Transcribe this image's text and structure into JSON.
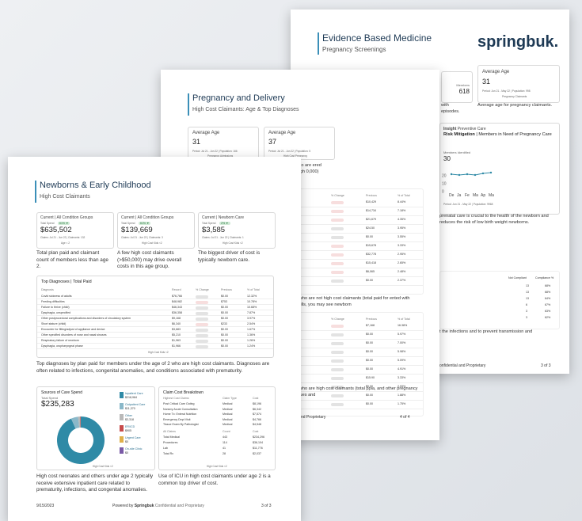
{
  "page3": {
    "title": "Evidence Based Medicine",
    "subtitle": "Pregnancy Screenings",
    "logo": "springbuk.",
    "kpis": [
      {
        "label": "Members",
        "value": "618"
      },
      {
        "label": "Average Age",
        "value": "31",
        "meta": "Period: Jun 21 - May 22 | Population: 998",
        "link": "Pregnancy Claimants"
      }
    ],
    "kpi_notes": [
      "with",
      "episodes."
    ],
    "avg_age_note": "Average age for pregnancy claimants.",
    "insight_title_bold": "Risk Mitigation",
    "insight_title_rest": "| Members in Need of Pregnancy Care",
    "insight_kicker": "Insight",
    "insight_kicker_rest": "Preventive Care",
    "members_identified_label": "Members Identified",
    "members_identified_value": "30",
    "line_chart": {
      "values": [
        22,
        21,
        22,
        21,
        23,
        24
      ],
      "xlabels": [
        "De",
        "Ja",
        "Fe",
        "Ma",
        "Ap",
        "Ma"
      ],
      "yticks": [
        "20",
        "10",
        "0"
      ],
      "meta": "Period: Jun 21 - May 22 | Population: 9968"
    },
    "note1": "prenatal care is crucial to the health of the newborn and reduces the risk of low birth weight newborns.",
    "compliance_header": [
      "Not Compliant",
      "Compliance %"
    ],
    "compliance_rows": [
      [
        "13",
        "68%"
      ],
      [
        "13",
        "68%"
      ],
      [
        "13",
        "64%"
      ],
      [
        "6",
        "67%"
      ],
      [
        "3",
        "63%"
      ],
      [
        "3",
        "62%"
      ]
    ],
    "note2": "t the infections and to prevent transmission and",
    "footer_left": "onfidential and Proprietary",
    "footer_right": "3 of 3"
  },
  "page2": {
    "title": "Pregnancy and Delivery",
    "subtitle": "High Cost Claimants: Age & Top Diagnoses",
    "kpis": [
      {
        "label": "Average Age",
        "value": "31",
        "meta": "Period: Jul 21 - Jun 22 | Population: 166",
        "link": "Pregnancy Admissions"
      },
      {
        "label": "Average Age",
        "value": "37",
        "meta": "Period: Jul 21 - Jun 22 | Population: 5",
        "link": "High Cost Pregnancy"
      }
    ],
    "right_note": "embers who are ered who are high 0,000)",
    "table1_header": [
      "Record",
      "% Change",
      "Previous",
      "% of Total"
    ],
    "table1_rows": [
      [
        "$25,168",
        "",
        "$10,429",
        "8.44%"
      ],
      [
        "$20,384",
        "",
        "$14,734",
        "7.18%"
      ],
      [
        "$12,628",
        "",
        "$21,679",
        "4.35%"
      ],
      [
        "$14,261",
        "",
        "$24.50",
        "3.95%"
      ],
      [
        "$15,120",
        "",
        "$0.00",
        "3.55%"
      ],
      [
        "$11,877",
        "",
        "$15,678",
        "3.33%"
      ],
      [
        "$10,720",
        "",
        "$32,778",
        "2.95%"
      ],
      [
        "$7,298",
        "",
        "$15,418",
        "2.65%"
      ],
      [
        "$9,018",
        "",
        "$6,065",
        "2.48%"
      ],
      [
        "$10,357",
        "",
        "$0.00",
        "2.37%"
      ]
    ],
    "note_mid": "members who are not high cost claimants (total paid for ented with maternal bills, you may see newborn",
    "table2_rows": [
      [
        "$86,719",
        "",
        "$7,168",
        "16.38%"
      ],
      [
        "$28,497",
        "",
        "$0.00",
        "5.97%"
      ],
      [
        "$29,161",
        "",
        "$0.00",
        "7.00%"
      ],
      [
        "$20,753",
        "",
        "$0.00",
        "5.98%"
      ],
      [
        "$20,808",
        "",
        "$0.00",
        "5.09%"
      ],
      [
        "$22,185",
        "",
        "$0.00",
        "4.91%"
      ],
      [
        "$14,862",
        "",
        "$15.90",
        "3.33%"
      ],
      [
        "$13,195",
        "",
        "$0.00",
        "2.93%"
      ],
      [
        "$9,130",
        "",
        "$0.00",
        "1.88%"
      ],
      [
        "$8,994",
        "",
        "$0.00",
        "1.75%"
      ]
    ],
    "note_bottom": "members who are high cost claimants (total ppia, and other pregnancy related issues and",
    "footer_left": "onfidential and Proprietary",
    "footer_right": "4 of 4"
  },
  "page1": {
    "title": "Newborns & Early Childhood",
    "subtitle": "High Cost Claimants",
    "kpis": [
      {
        "heading": "Current | All Condition Groups",
        "label": "Total Spend",
        "badge": "61% ▼",
        "value": "$635,502",
        "meta": "Claims: Jul 21 - Jun 22 | Claimants: 132",
        "link": "Age < 2"
      },
      {
        "heading": "Current | All Condition Groups",
        "label": "Total Spend",
        "badge": "61% ▼",
        "value": "$139,669",
        "meta": "Claims: Jul 21 - Jun 22 | Claimants: 3",
        "link": "High Cost Kids <2"
      },
      {
        "heading": "Current | Newborn Care",
        "label": "Total Spend",
        "badge": "2% ▼",
        "value": "$3,585",
        "meta": "Claims: Jul 21 - Jun 22 | Claimants: 1",
        "link": "High Cost Kids <2"
      }
    ],
    "kpi_notes": [
      "Total plan paid and claimant count of members less than age 2.",
      "A few high cost claimants (>$50,000) may drive overall costs in this age group.",
      "The biggest driver of cost is typically newborn care."
    ],
    "diag_title": "Top Diagnoses | Total Paid",
    "diag_header": [
      "Diagnosis",
      "Record",
      "% Change",
      "Previous",
      "% of Total"
    ],
    "diag_rows": [
      [
        "Covid sickness of adults",
        "$76,766",
        "",
        "$0.00",
        "12.32%"
      ],
      [
        "Feeding difficulties",
        "$48,982",
        "",
        "$753",
        "10.78%"
      ],
      [
        "Failure to thrive (child)",
        "$46,343",
        "",
        "$0.00",
        "10.68%"
      ],
      [
        "Dysphagia, unspecified",
        "$36,358",
        "",
        "$0.00",
        "7.87%"
      ],
      [
        "Other postprocedural complications and disorders of circulatory system",
        "$9,168",
        "",
        "$0.00",
        "3.97%"
      ],
      [
        "Short stature (child)",
        "$6,340",
        "",
        "$233",
        "2.54%"
      ],
      [
        "Encounter for fitting/adjust of appliance and device",
        "$3,683",
        "",
        "$0.00",
        "1.67%"
      ],
      [
        "Other specified disorders of nose and nasal sinuses",
        "$5,210",
        "",
        "$0.00",
        "1.36%"
      ],
      [
        "Respiratory failure of newborn",
        "$1,963",
        "",
        "$0.00",
        "1.26%"
      ],
      [
        "Dysphagia, oropharyngeal phase",
        "$1,966",
        "",
        "$0.00",
        "1.24%"
      ]
    ],
    "diag_link": "High Cost Kids <2",
    "diag_note": "Top diagnoses by plan paid for members under the age of 2 who are high cost claimants.  Diagnoses are often related to infections, congenital anomalies, and conditions associated with prematurity.",
    "sources_title": "Sources of Care Spend",
    "sources_label": "Total Spend",
    "sources_total": "$235,283",
    "sources": [
      {
        "name": "Inpatient Care",
        "value": "$218,984",
        "color": "#2f8aa6"
      },
      {
        "name": "Outpatient Care",
        "value": "$11,370",
        "color": "#8ab8c9"
      },
      {
        "name": "Other",
        "value": "$3,318",
        "color": "#b9b9b9"
      },
      {
        "name": "ER/ICD",
        "value": "$905",
        "color": "#c74b4b"
      },
      {
        "name": "Urgent Care",
        "value": "$0",
        "color": "#e0b04a"
      },
      {
        "name": "On-site Clinic",
        "value": "$0",
        "color": "#7a5aa6"
      }
    ],
    "sources_link": "High Cost Kids <2",
    "breakdown_title": "Claim Cost Breakdown",
    "breakdown_header": [
      "Highest Cost Claims",
      "Claim Type",
      "Cost"
    ],
    "breakdown_rows": [
      [
        "Post Critical Care Outing",
        "Medical",
        "$8,196"
      ],
      [
        "Nursery Acute Consultation",
        "Medical",
        "$6,342"
      ],
      [
        "Home Tx: Enteral Nutrition",
        "Medical",
        "$7,574"
      ],
      [
        "Emergency Dept Visit",
        "Medical",
        "$4,766"
      ],
      [
        "Tissue Exam By Pathologist",
        "Medical",
        "$4,548"
      ]
    ],
    "breakdown_header2": [
      "All Claims",
      "Count",
      "Cost"
    ],
    "breakdown_rows2": [
      [
        "Total Medical",
        "443",
        "$234,296"
      ],
      [
        "Procedures",
        "114",
        "$36,104"
      ],
      [
        "Lab",
        "41",
        "$11,776"
      ],
      [
        "Total Rx",
        "28",
        "$2,037"
      ]
    ],
    "breakdown_link": "High Cost Kids <2",
    "sources_note": "High cost neonates and others under age 2 typically receive extensive inpatient care related to prematurity, infections, and congenital anomalies.",
    "breakdown_note": "Use of ICU in high cost claimants under age 2 is a common top driver of cost.",
    "footer_date": "9/15/2023",
    "footer_powered": "Powered by",
    "footer_brand": "Springbuk",
    "footer_conf": "Confidential and Proprietary",
    "footer_page": "3 of 3"
  },
  "donut": {
    "values": [
      218984,
      11370,
      3318,
      905,
      0,
      0
    ]
  }
}
